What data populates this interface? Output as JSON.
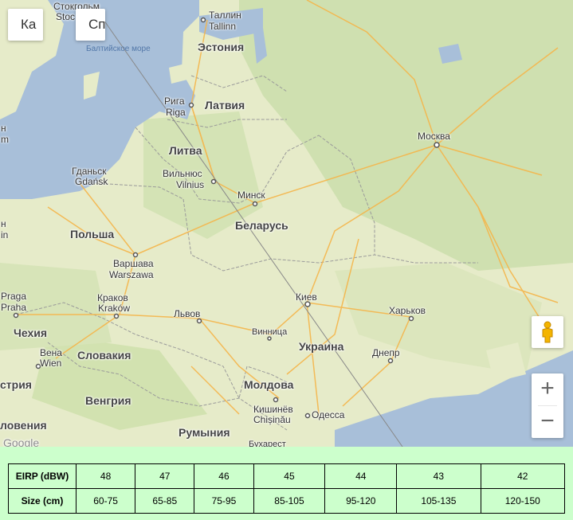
{
  "map": {
    "controls": {
      "maptype_map": "Ка",
      "maptype_satellite": "Сп",
      "zoom_in": "+",
      "zoom_out": "−"
    },
    "sea_label": "Балтийское море",
    "countries": {
      "estonia": "Эстония",
      "latvia": "Латвия",
      "lithuania": "Литва",
      "belarus": "Беларусь",
      "poland": "Польша",
      "czech": "Чехия",
      "slovakia": "Словакия",
      "hungary": "Венгрия",
      "romania": "Румыния",
      "moldova": "Молдова",
      "ukraine": "Украина",
      "austria": "стрия",
      "slovenia": "ловения"
    },
    "cities": {
      "stockholm": "Стокгольм",
      "stockholm_latin": "Stoc",
      "tallinn": "Таллин",
      "tallinn_latin": "Tallinn",
      "riga": "Рига",
      "riga_latin": "Riga",
      "gdansk": "Гданьск",
      "gdansk_latin": "Gdańsk",
      "vilnius": "Вильнюс",
      "vilnius_latin": "Vilnius",
      "minsk": "Минск",
      "moscow": "Москва",
      "warsaw": "Варшава",
      "warsaw_latin": "Warszawa",
      "prague": "Praga",
      "prague_latin": "Praha",
      "krakow": "Краков",
      "krakow_latin": "Kraków",
      "lviv": "Львов",
      "kiev": "Киев",
      "kharkov": "Харьков",
      "vinnitsa": "Винница",
      "vienna": "Вена",
      "vienna_latin": "Wien",
      "dnepr": "Днепр",
      "chisinau": "Кишинёв",
      "chisinau_latin": "Chișinău",
      "odessa": "Одесса",
      "left_edge_1": "н",
      "left_edge_2": "m",
      "left_edge_3": "н",
      "left_edge_4": "in"
    },
    "attribution": "Google",
    "bottom_cut": "Бухарест"
  },
  "table": {
    "row1_header": "EIRP (dBW)",
    "row2_header": "Size (cm)",
    "eirp": [
      "48",
      "47",
      "46",
      "45",
      "44",
      "43",
      "42"
    ],
    "size": [
      "60-75",
      "65-85",
      "75-95",
      "85-105",
      "95-120",
      "105-135",
      "120-150"
    ]
  }
}
